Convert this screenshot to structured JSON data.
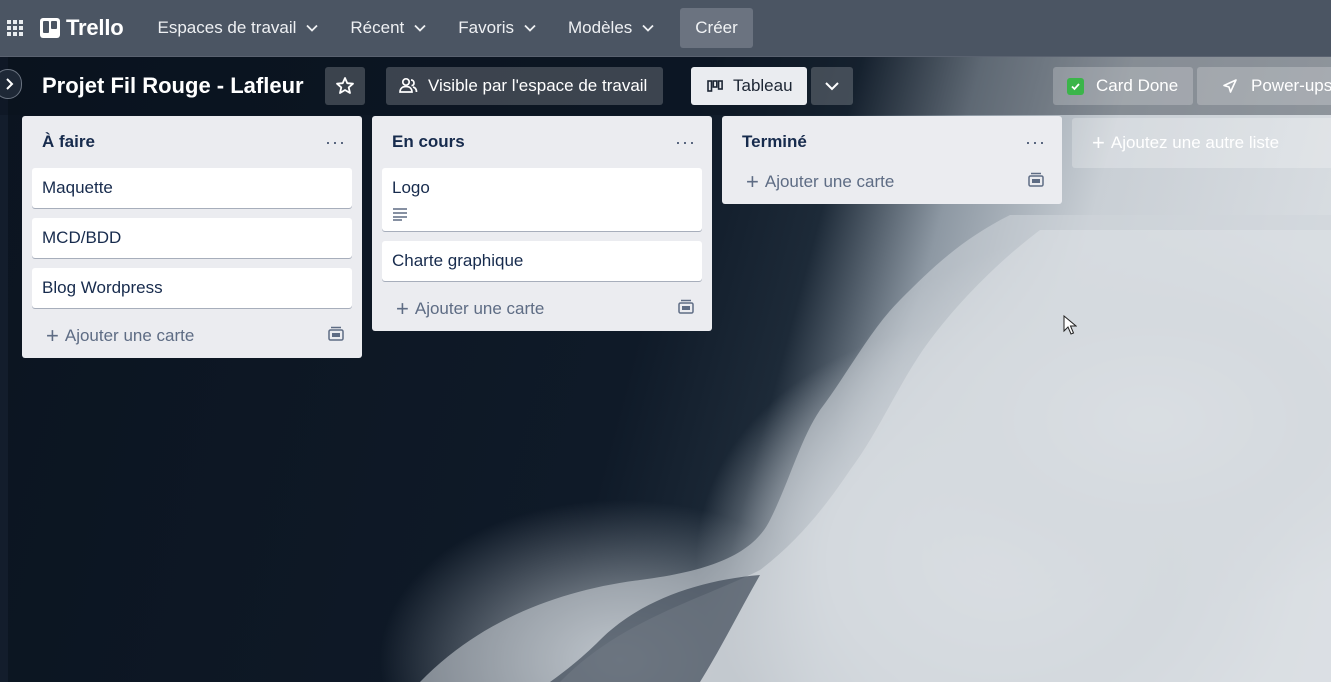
{
  "header": {
    "logo_text": "Trello",
    "nav": [
      {
        "label": "Espaces de travail"
      },
      {
        "label": "Récent"
      },
      {
        "label": "Favoris"
      },
      {
        "label": "Modèles"
      }
    ],
    "create_label": "Créer"
  },
  "board": {
    "title": "Projet Fil Rouge - Lafleur",
    "visibility_label": "Visible par l'espace de travail",
    "view_label": "Tableau",
    "card_done_label": "Card Done",
    "powerups_label": "Power-ups"
  },
  "lists": [
    {
      "title": "À faire",
      "menu": "···",
      "cards": [
        {
          "title": "Maquette"
        },
        {
          "title": "MCD/BDD"
        },
        {
          "title": "Blog Wordpress"
        }
      ],
      "add_label": "Ajouter une carte"
    },
    {
      "title": "En cours",
      "menu": "···",
      "cards": [
        {
          "title": "Logo",
          "has_description": true
        },
        {
          "title": "Charte graphique"
        }
      ],
      "add_label": "Ajouter une carte"
    },
    {
      "title": "Terminé",
      "menu": "···",
      "cards": [],
      "add_label": "Ajouter une carte"
    }
  ],
  "add_list_label": "Ajoutez une autre liste",
  "icons": {
    "apps": "apps-grid-icon",
    "star": "star-icon",
    "visibility": "workspace-people-icon",
    "board_view": "board-view-icon",
    "card_template": "card-template-icon",
    "description": "description-lines-icon",
    "rocket": "rocket-icon",
    "check": "check-icon"
  },
  "colors": {
    "header_bg": "#4b5563",
    "list_bg": "#ebecf0",
    "card_done_green": "#3bb54a"
  }
}
